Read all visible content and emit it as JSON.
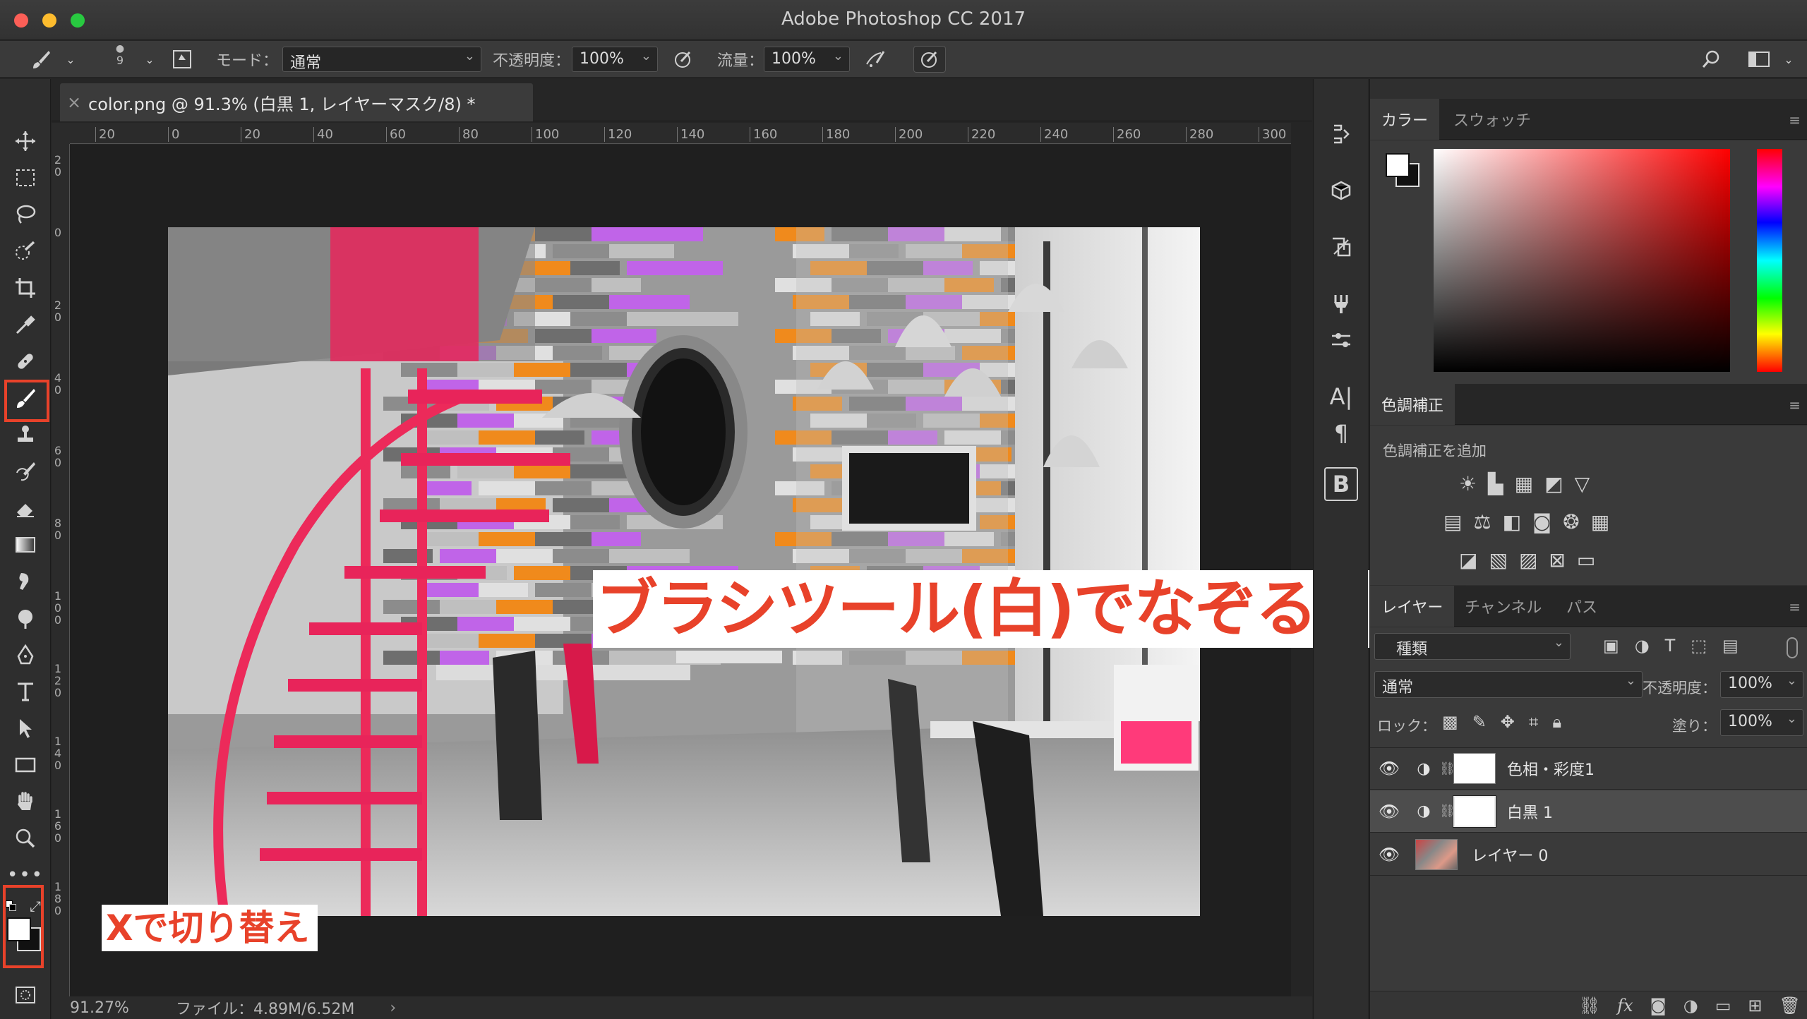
{
  "window": {
    "title": "Adobe Photoshop CC 2017"
  },
  "options": {
    "brush_size": "9",
    "mode_label": "モード：",
    "mode_value": "通常",
    "opacity_label": "不透明度：",
    "opacity_value": "100%",
    "flow_label": "流量：",
    "flow_value": "100%"
  },
  "document": {
    "tab_title": "color.png @ 91.3% (白黒 1, レイヤーマスク/8) *",
    "ruler_h": [
      "20",
      "0",
      "20",
      "40",
      "60",
      "80",
      "100",
      "120",
      "140",
      "160",
      "180",
      "200",
      "220",
      "240",
      "260",
      "280",
      "300"
    ],
    "ruler_v": [
      "2 0",
      "0",
      "2 0",
      "4 0",
      "6 0",
      "8 0",
      "1 0 0",
      "1 2 0",
      "1 4 0",
      "1 6 0",
      "1 8 0"
    ]
  },
  "status": {
    "zoom": "91.27%",
    "file": "ファイル：4.89M/6.52M"
  },
  "annotations": {
    "main": "ブラシツール(白)でなぞる",
    "swap": "Xで切り替え",
    "color_main": "#e8422a"
  },
  "color_panel": {
    "tabs": [
      "カラー",
      "スウォッチ"
    ]
  },
  "adjust_panel": {
    "tab": "色調補正",
    "subtitle": "色調補正を追加"
  },
  "layers_panel": {
    "tabs": [
      "レイヤー",
      "チャンネル",
      "パス"
    ],
    "filter": "種類",
    "blend": "通常",
    "opacity_label": "不透明度：",
    "opacity_value": "100%",
    "lock_label": "ロック：",
    "fill_label": "塗り：",
    "fill_value": "100%",
    "layers": [
      {
        "name": "色相・彩度1"
      },
      {
        "name": "白黒 1"
      },
      {
        "name": "レイヤー 0"
      }
    ]
  }
}
